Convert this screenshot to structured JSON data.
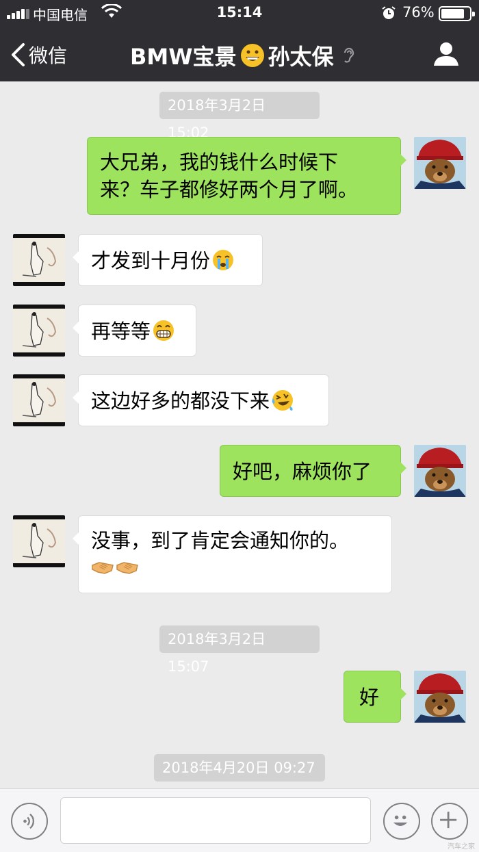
{
  "status_bar": {
    "carrier": "中国电信",
    "time": "15:14",
    "battery": "76%"
  },
  "nav": {
    "back_label": "微信",
    "title_part1": "BMW宝景",
    "title_part2": "孙太保"
  },
  "messages": [
    {
      "type": "timestamp",
      "text": "2018年3月2日 15:02"
    },
    {
      "type": "me",
      "line1": "大兄弟，我的钱什么时候下",
      "line2": "来？车子都修好两个月了啊。"
    },
    {
      "type": "other",
      "text": "才发到十月份",
      "emoji": "crying-face-icon"
    },
    {
      "type": "other",
      "text": "再等等",
      "emoji": "grinning-face-icon"
    },
    {
      "type": "other",
      "text": "这边好多的都没下来",
      "emoji": "laughing-tears-face-icon"
    },
    {
      "type": "me",
      "text": "好吧，麻烦你了"
    },
    {
      "type": "other",
      "text": "没事，到了肯定会通知你的。",
      "emoji": "handshake-icon"
    },
    {
      "type": "timestamp",
      "text": "2018年3月2日 15:07"
    },
    {
      "type": "me",
      "text": "好"
    },
    {
      "type": "timestamp",
      "text": "2018年4月20日 09:27"
    }
  ],
  "input": {
    "placeholder": ""
  },
  "watermark": "汽车之家",
  "colors": {
    "header_bg": "#2e2e33",
    "chat_bg": "#ebebeb",
    "my_bubble": "#9de35d",
    "other_bubble": "#ffffff",
    "timestamp_bg": "#d2d2d2"
  }
}
